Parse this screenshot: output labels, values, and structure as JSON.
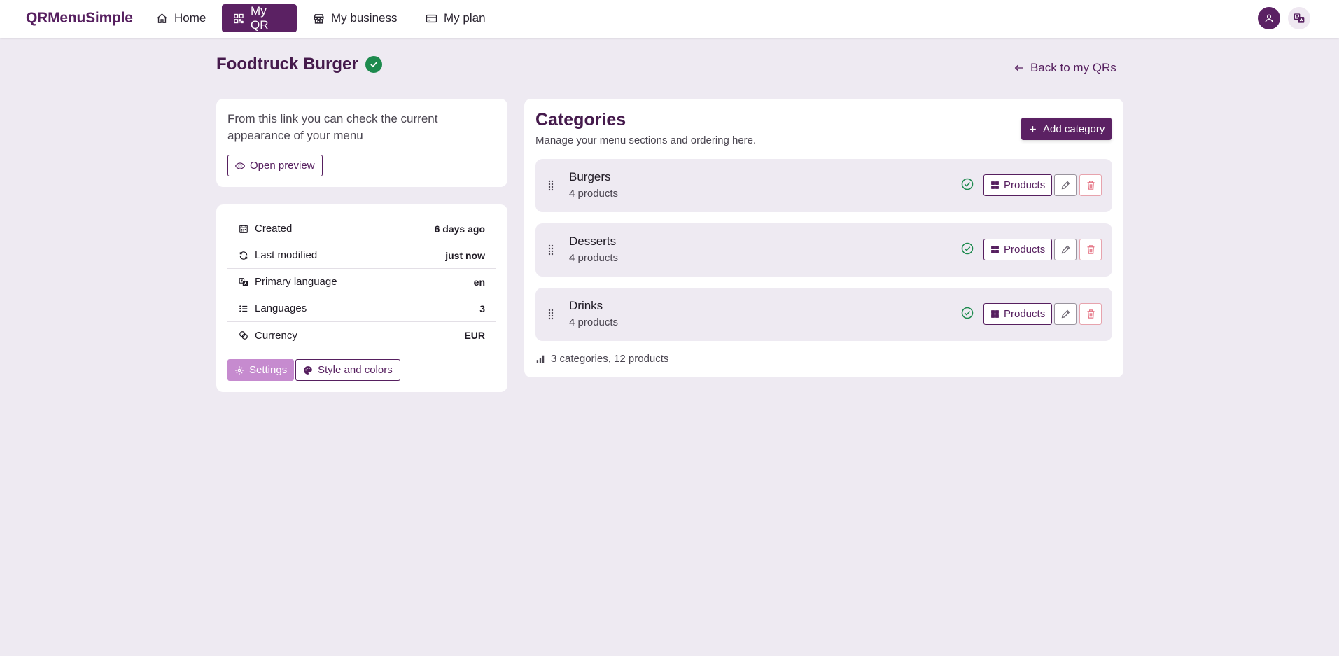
{
  "brand": "QRMenuSimple",
  "nav": {
    "home": "Home",
    "my_qr": "My QR",
    "my_business": "My business",
    "my_plan": "My plan"
  },
  "colors": {
    "primary": "#5b2163",
    "accent_light": "#c68bcf",
    "success": "#1d8a4e",
    "danger": "#e7a3ad",
    "background": "#eeeaf2"
  },
  "page": {
    "title": "Foodtruck Burger",
    "back_link": "Back to my QRs"
  },
  "preview": {
    "text": "From this link you can check the current appearance of your menu",
    "button": "Open preview"
  },
  "info": {
    "rows": [
      {
        "icon": "calendar-icon",
        "label": "Created",
        "value": "6 days ago"
      },
      {
        "icon": "refresh-icon",
        "label": "Last modified",
        "value": "just now"
      },
      {
        "icon": "translate-icon",
        "label": "Primary language",
        "value": "en"
      },
      {
        "icon": "list-icon",
        "label": "Languages",
        "value": "3"
      },
      {
        "icon": "coins-icon",
        "label": "Currency",
        "value": "EUR"
      }
    ],
    "settings_button": "Settings",
    "style_button": "Style and colors"
  },
  "categories": {
    "title": "Categories",
    "subtitle": "Manage your menu sections and ordering here.",
    "add_button": "Add category",
    "products_label": "Products",
    "items": [
      {
        "name": "Burgers",
        "count": "4 products"
      },
      {
        "name": "Desserts",
        "count": "4 products"
      },
      {
        "name": "Drinks",
        "count": "4 products"
      }
    ],
    "summary": "3 categories, 12 products"
  }
}
